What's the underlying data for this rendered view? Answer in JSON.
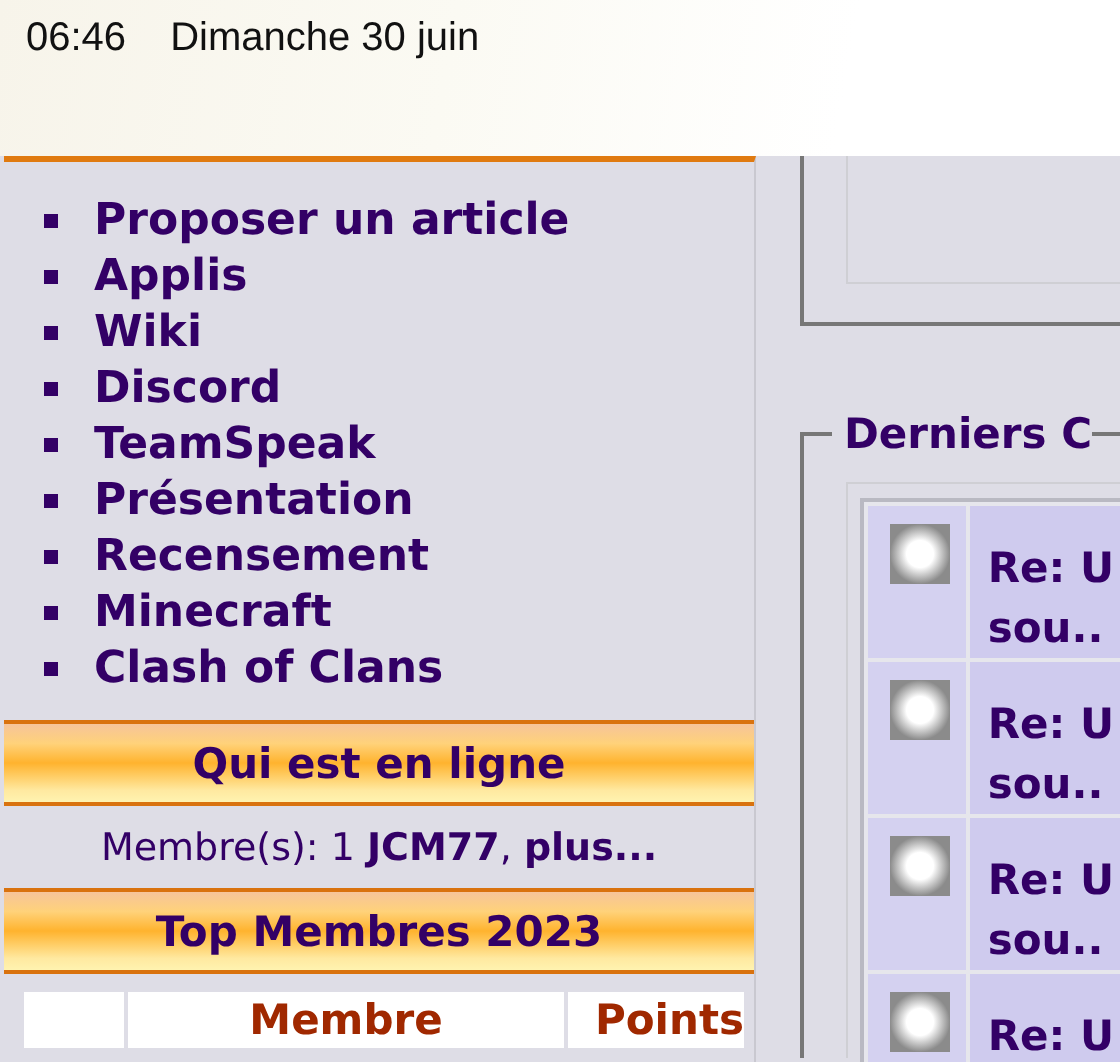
{
  "status_bar": {
    "time": "06:46",
    "date": "Dimanche 30 juin"
  },
  "sidebar": {
    "links": [
      {
        "label": "Proposer un article"
      },
      {
        "label": "Applis"
      },
      {
        "label": "Wiki"
      },
      {
        "label": "Discord"
      },
      {
        "label": "TeamSpeak"
      },
      {
        "label": "Présentation"
      },
      {
        "label": "Recensement"
      },
      {
        "label": "Minecraft"
      },
      {
        "label": "Clash of Clans"
      }
    ],
    "online": {
      "title": "Qui est en ligne",
      "text": "Membre(s): 1 **JCM77**, **plus...**"
    },
    "top_members": {
      "title": "Top Membres 2023",
      "columns": [
        "Membre",
        "Points"
      ]
    }
  },
  "recent_posts": {
    "title": "Derniers C",
    "rows": [
      {
        "lines": [
          "Re: U",
          "sou.."
        ]
      },
      {
        "lines": [
          "Re: U",
          "sou.."
        ]
      },
      {
        "lines": [
          "Re: U",
          "sou.."
        ]
      },
      {
        "lines": [
          "Re: U"
        ]
      }
    ]
  }
}
